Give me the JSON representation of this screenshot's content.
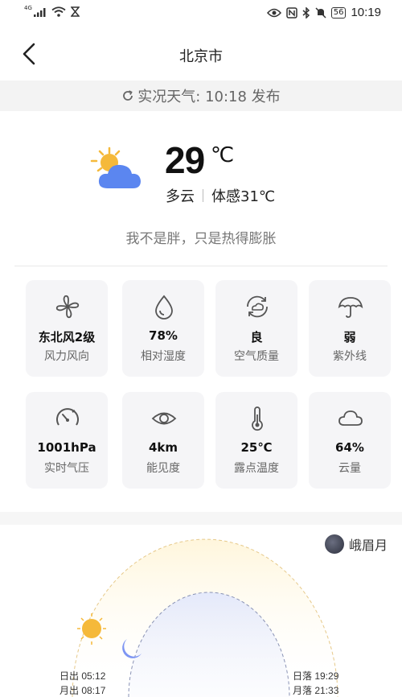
{
  "status_bar": {
    "network": "4G",
    "time": "10:19",
    "battery": "56"
  },
  "nav": {
    "title": "北京市"
  },
  "update": {
    "text": "实况天气: 10:18 发布"
  },
  "current": {
    "temperature": "29",
    "unit": "℃",
    "condition": "多云",
    "feels_like": "体感31℃",
    "slogan": "我不是胖，只是热得膨胀"
  },
  "details": [
    {
      "icon": "fan-icon",
      "value": "东北风2级",
      "label": "风力风向"
    },
    {
      "icon": "humidity-drop-icon",
      "value": "78%",
      "label": "相对湿度"
    },
    {
      "icon": "air-quality-icon",
      "value": "良",
      "label": "空气质量"
    },
    {
      "icon": "umbrella-icon",
      "value": "弱",
      "label": "紫外线"
    },
    {
      "icon": "gauge-icon",
      "value": "1001hPa",
      "label": "实时气压"
    },
    {
      "icon": "eye-icon",
      "value": "4km",
      "label": "能见度"
    },
    {
      "icon": "thermometer-icon",
      "value": "25℃",
      "label": "露点温度"
    },
    {
      "icon": "cloud-icon",
      "value": "64%",
      "label": "云量"
    }
  ],
  "sun_moon": {
    "moon_phase": "峨眉月",
    "sunrise": "日出 05:12",
    "moonrise": "月出 08:17",
    "sunset": "日落 19:29",
    "moonset": "月落 21:33"
  },
  "colors": {
    "sun": "#f5b93a",
    "cloud": "#5b86f0",
    "moon": "#7d95f3",
    "card_bg": "#f5f5f7"
  }
}
